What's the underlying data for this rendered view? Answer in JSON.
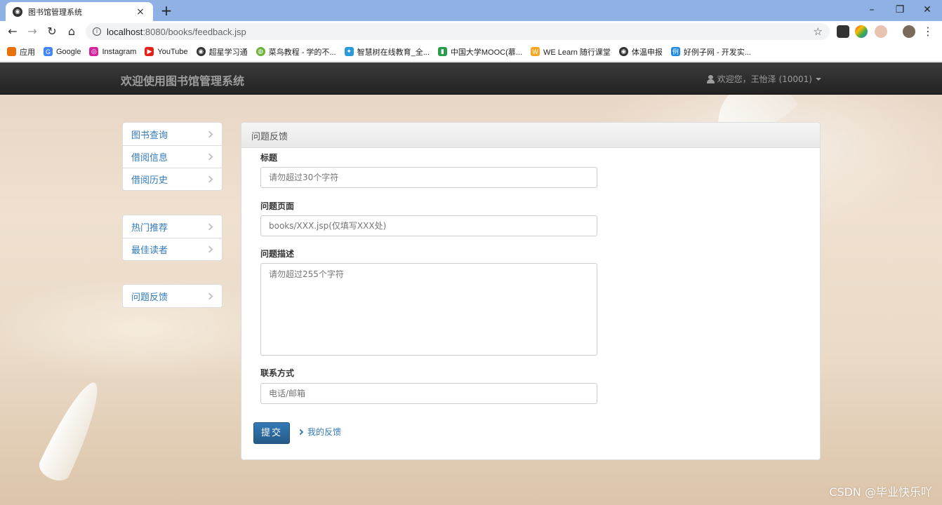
{
  "browser": {
    "tab_title": "图书馆管理系统",
    "tab_close": "×",
    "new_tab": "+",
    "url_host": "localhost",
    "url_rest": ":8080/books/feedback.jsp",
    "window_controls": [
      "–",
      "❐",
      "✕"
    ]
  },
  "bookmarks": [
    {
      "label": "应用",
      "icon": "apps-grid-icon",
      "color": "#e8710a"
    },
    {
      "label": "Google",
      "icon": "google-icon",
      "color": "#4285f4"
    },
    {
      "label": "Instagram",
      "icon": "instagram-icon",
      "color": "#d6249f"
    },
    {
      "label": "YouTube",
      "icon": "youtube-icon",
      "color": "#e62117"
    },
    {
      "label": "超星学习通",
      "icon": "globe-icon",
      "color": "#333333"
    },
    {
      "label": "菜鸟教程 - 学的不...",
      "icon": "runoob-icon",
      "color": "#6bb13b"
    },
    {
      "label": "智慧树在线教育_全...",
      "icon": "zhihuishu-icon",
      "color": "#2a9bd8"
    },
    {
      "label": "中国大学MOOC(慕...",
      "icon": "mooc-icon",
      "color": "#2a9d4b"
    },
    {
      "label": "WE Learn 随行课堂",
      "icon": "welearn-icon",
      "color": "#f5a623"
    },
    {
      "label": "体温申报",
      "icon": "globe-icon",
      "color": "#333333"
    },
    {
      "label": "好例子网 - 开发实...",
      "icon": "haolizi-icon",
      "color": "#1e88e5"
    }
  ],
  "navbar": {
    "brand": "欢迎使用图书馆管理系统",
    "user": "欢迎您，王怡泽 (10001)"
  },
  "sidebar": {
    "group1": [
      "图书查询",
      "借阅信息",
      "借阅历史"
    ],
    "group2": [
      "热门推荐",
      "最佳读者"
    ],
    "group3": [
      "问题反馈"
    ]
  },
  "panel": {
    "heading": "问题反馈",
    "title_label": "标题",
    "title_placeholder": "请勿超过30个字符",
    "page_label": "问题页面",
    "page_placeholder": "books/XXX.jsp(仅填写XXX处)",
    "desc_label": "问题描述",
    "desc_placeholder": "请勿超过255个字符",
    "contact_label": "联系方式",
    "contact_placeholder": "电话/邮箱",
    "submit": "提交",
    "my_feedback": "我的反馈"
  },
  "watermark": "CSDN @毕业快乐吖"
}
